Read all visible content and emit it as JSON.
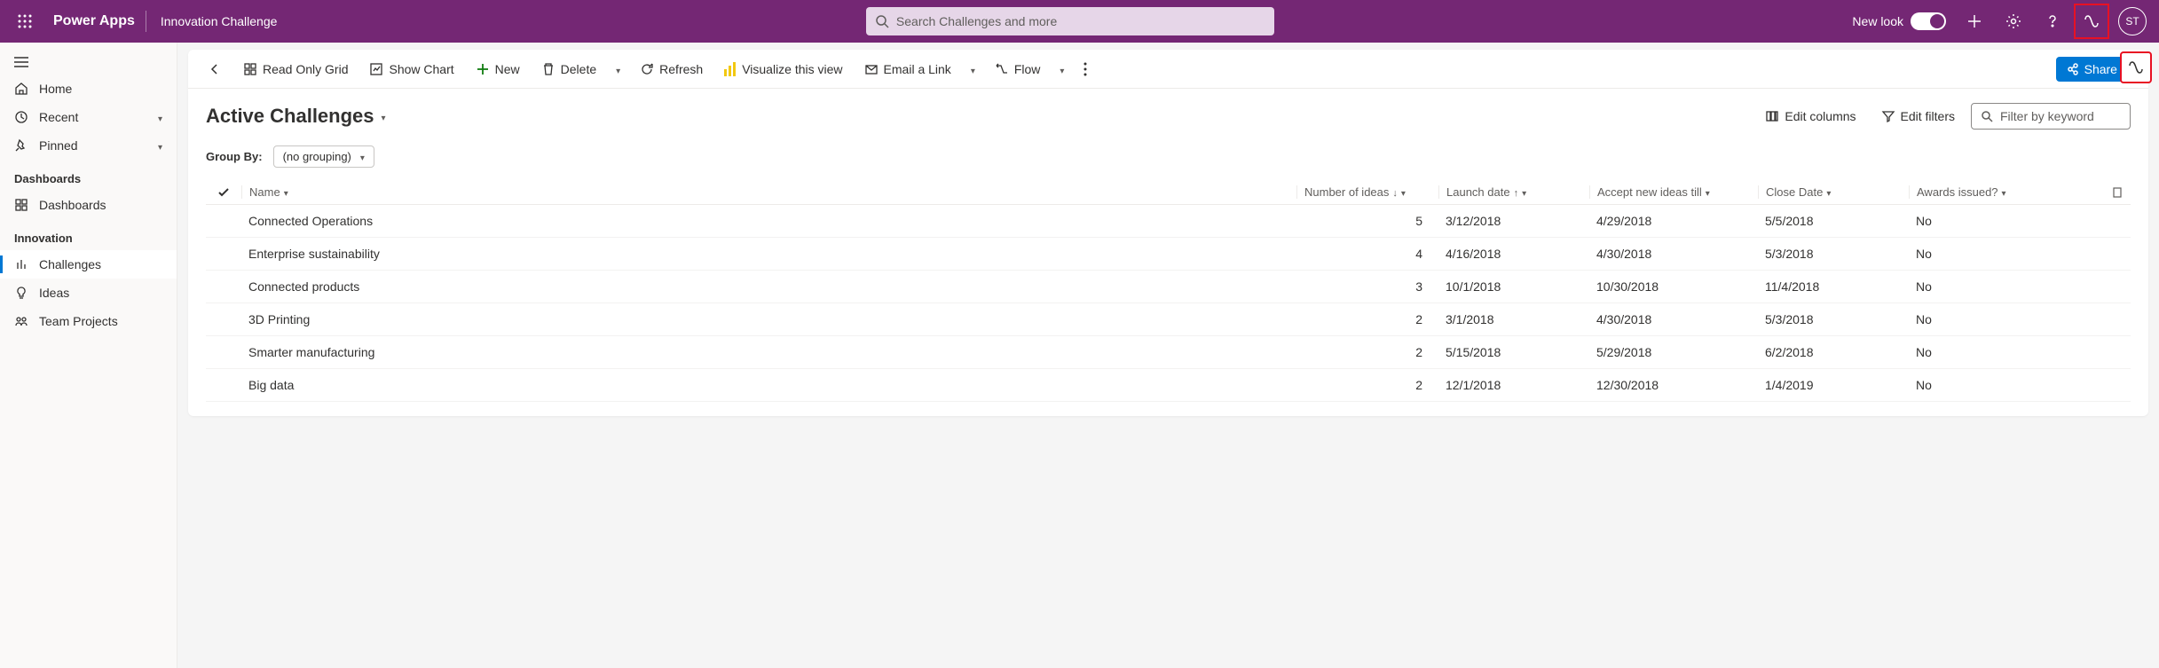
{
  "header": {
    "brand": "Power Apps",
    "app_title": "Innovation Challenge",
    "search_placeholder": "Search Challenges and more",
    "new_look_label": "New look",
    "avatar_initials": "ST"
  },
  "sidebar": {
    "home": "Home",
    "recent": "Recent",
    "pinned": "Pinned",
    "section_dashboards": "Dashboards",
    "dashboards_item": "Dashboards",
    "section_innovation": "Innovation",
    "challenges": "Challenges",
    "ideas": "Ideas",
    "team_projects": "Team Projects"
  },
  "commandbar": {
    "read_only_grid": "Read Only Grid",
    "show_chart": "Show Chart",
    "new": "New",
    "delete": "Delete",
    "refresh": "Refresh",
    "visualize": "Visualize this view",
    "email_link": "Email a Link",
    "flow": "Flow",
    "share": "Share"
  },
  "view": {
    "title": "Active Challenges",
    "edit_columns": "Edit columns",
    "edit_filters": "Edit filters",
    "filter_placeholder": "Filter by keyword",
    "group_by_label": "Group By:",
    "group_by_value": "(no grouping)"
  },
  "columns": {
    "name": "Name",
    "ideas": "Number of ideas",
    "launch": "Launch date",
    "accept": "Accept new ideas till",
    "close": "Close Date",
    "awards": "Awards issued?"
  },
  "rows": [
    {
      "name": "Connected Operations",
      "ideas": "5",
      "launch": "3/12/2018",
      "accept": "4/29/2018",
      "close": "5/5/2018",
      "awards": "No"
    },
    {
      "name": "Enterprise sustainability",
      "ideas": "4",
      "launch": "4/16/2018",
      "accept": "4/30/2018",
      "close": "5/3/2018",
      "awards": "No"
    },
    {
      "name": "Connected products",
      "ideas": "3",
      "launch": "10/1/2018",
      "accept": "10/30/2018",
      "close": "11/4/2018",
      "awards": "No"
    },
    {
      "name": "3D Printing",
      "ideas": "2",
      "launch": "3/1/2018",
      "accept": "4/30/2018",
      "close": "5/3/2018",
      "awards": "No"
    },
    {
      "name": "Smarter manufacturing",
      "ideas": "2",
      "launch": "5/15/2018",
      "accept": "5/29/2018",
      "close": "6/2/2018",
      "awards": "No"
    },
    {
      "name": "Big data",
      "ideas": "2",
      "launch": "12/1/2018",
      "accept": "12/30/2018",
      "close": "1/4/2019",
      "awards": "No"
    }
  ]
}
